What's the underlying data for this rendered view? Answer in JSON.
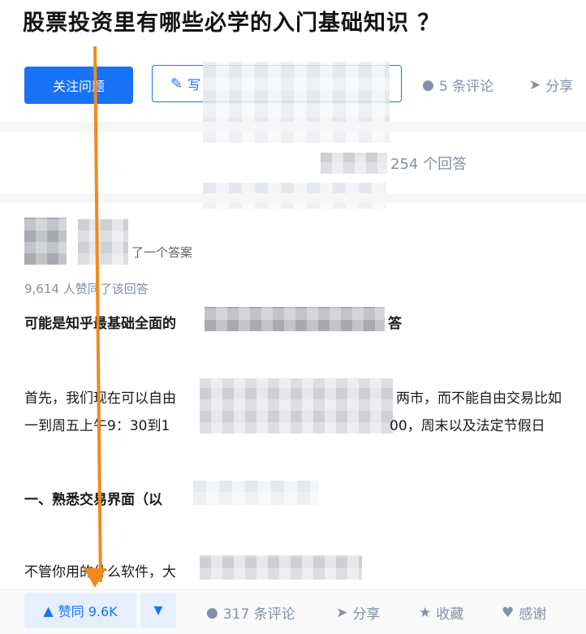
{
  "question": {
    "title": "股票投资里有哪些必学的入门基础知识 ？",
    "follow_label": "关注问题",
    "write_label": "写",
    "comments_label": "5 条评论",
    "share_label": "分享",
    "answer_count_label": "254 个回答"
  },
  "answer": {
    "author_note": "了一个答案",
    "upvote_info": "9,614 人赞同了该回答",
    "lines": [
      "可能是知乎最基础全面的",
      "答",
      "首先，我们现在可以自由",
      "两市，而不能自由交易比如",
      "一到周五上午9：30到1",
      "00，周末以及法定节假日",
      "一、熟悉交易界面（以",
      "不管你用的什么软件，大"
    ]
  },
  "actions": {
    "vote_up_label": "赞同 9.6K",
    "comments_label": "317 条评论",
    "share_label": "分享",
    "favorite_label": "收藏",
    "thanks_label": "感谢"
  },
  "icons": {
    "pen": "pen-icon",
    "comment": "comment-icon",
    "share": "share-icon",
    "star": "star-icon",
    "heart": "heart-icon",
    "vote_up": "triangle-up-icon",
    "vote_down": "triangle-down-icon"
  },
  "colors": {
    "brand_blue": "#1772f6",
    "meta_gray": "#8590a6",
    "annotation_orange": "#f18a1c"
  }
}
